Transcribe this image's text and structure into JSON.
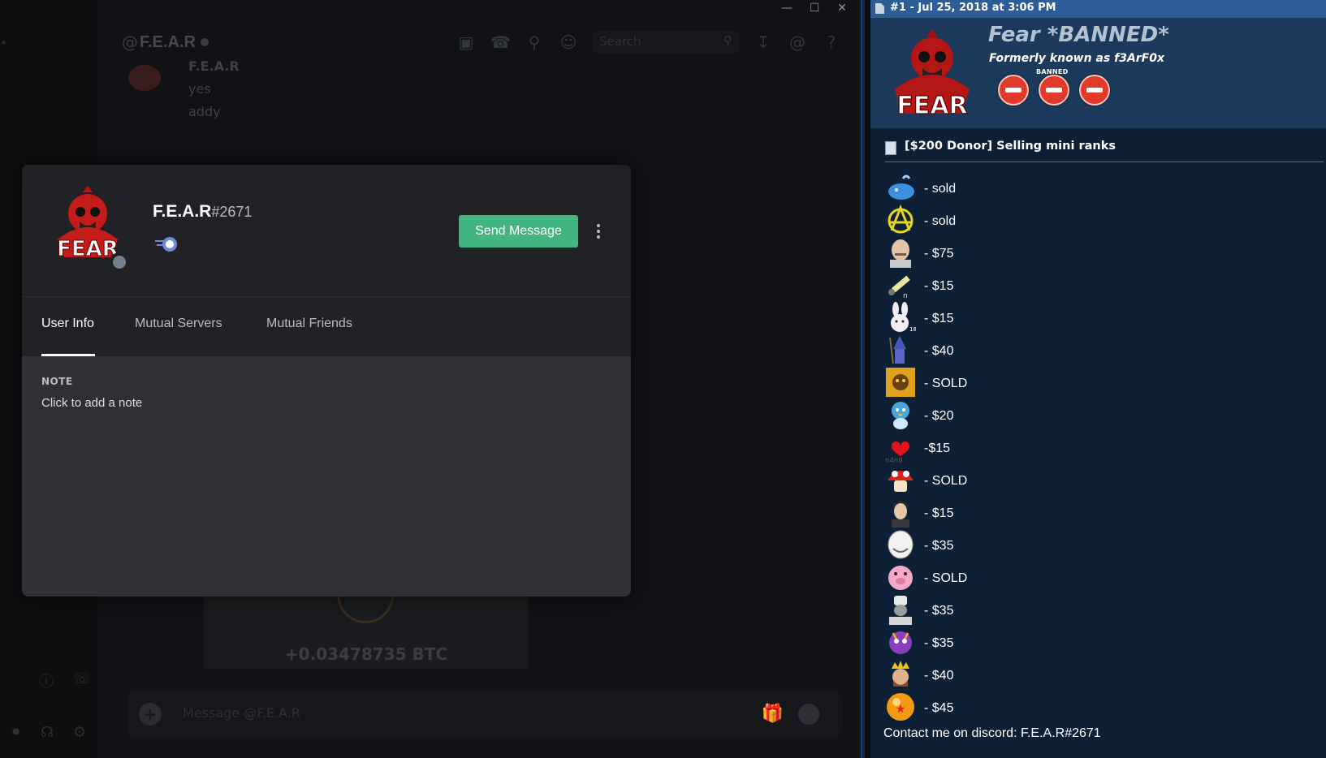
{
  "discord": {
    "channel_at": "@",
    "channel_name": "F.E.A.R",
    "search_placeholder": "Search",
    "bg_messages": [
      {
        "author": "F.E.A.R",
        "lines": [
          "yes",
          "addy"
        ]
      }
    ],
    "btc_amount": "+0.03478735 BTC",
    "message_placeholder": "Message @F.E.A.R",
    "window_controls": [
      "minimize",
      "maximize",
      "close"
    ]
  },
  "profile": {
    "username": "F.E.A.R",
    "discriminator": "#2671",
    "status": "offline",
    "send_message_label": "Send Message",
    "tabs": [
      "User Info",
      "Mutual Servers",
      "Mutual Friends"
    ],
    "active_tab": "User Info",
    "note_title": "NOTE",
    "note_placeholder": "Click to add a note"
  },
  "forum": {
    "post_header": "#1 - Jul 25, 2018 at 3:06 PM",
    "author_name": "Fear *BANNED*",
    "author_subtitle": "Formerly known as f3ArF0x",
    "banned_label": "BANNED",
    "thread_title": "[$200 Donor] Selling mini ranks",
    "ranks": [
      {
        "icon": "whale-icon",
        "text": "- sold"
      },
      {
        "icon": "anarchy-icon",
        "text": "- sold"
      },
      {
        "icon": "bald-man-icon",
        "text": "- $75"
      },
      {
        "icon": "syringe-icon",
        "text": "- $15"
      },
      {
        "icon": "bunny-icon",
        "text": "- $15"
      },
      {
        "icon": "wizard-icon",
        "text": "- $40"
      },
      {
        "icon": "lion-icon",
        "text": "- SOLD"
      },
      {
        "icon": "piplup-icon",
        "text": "- $20"
      },
      {
        "icon": "heart-icon",
        "text": "-$15"
      },
      {
        "icon": "mushroom-icon",
        "text": "- SOLD"
      },
      {
        "icon": "man-portrait-icon",
        "text": "- $15"
      },
      {
        "icon": "troll-face-icon",
        "text": "- $35"
      },
      {
        "icon": "pig-icon",
        "text": "- SOLD"
      },
      {
        "icon": "chef-icon",
        "text": "- $35"
      },
      {
        "icon": "spyro-icon",
        "text": "- $35"
      },
      {
        "icon": "king-icon",
        "text": "- $40"
      },
      {
        "icon": "dragon-ball-icon",
        "text": "- $45"
      }
    ],
    "contact": "Contact me on discord: F.E.A.R#2671"
  },
  "colors": {
    "send_button": "#43b581",
    "modal_bg": "#2f3136",
    "forum_bg": "#0e2036",
    "post_bar": "#2c5d97",
    "ban_red": "#e23a2a"
  }
}
